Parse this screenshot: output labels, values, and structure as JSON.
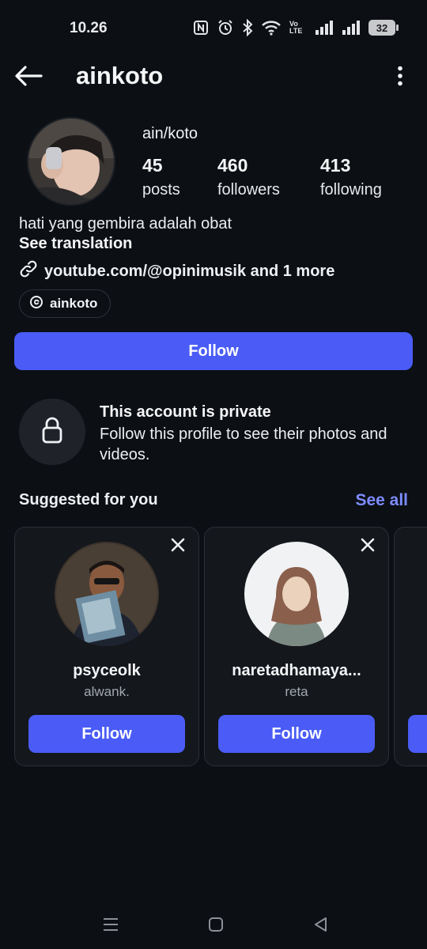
{
  "status_bar": {
    "time": "10.26",
    "battery": "32",
    "icons": [
      "nfc-icon",
      "alarm-icon",
      "bluetooth-icon",
      "wifi-icon",
      "volte-icon",
      "signal-icon",
      "signal-icon",
      "battery-icon"
    ],
    "volte_label": "Vo LTE"
  },
  "header": {
    "title": "ainkoto",
    "back_icon": "arrow-left-icon",
    "more_icon": "more-vertical-icon"
  },
  "profile": {
    "display_name": "ain/koto",
    "stats": [
      {
        "value": "45",
        "label": "posts"
      },
      {
        "value": "460",
        "label": "followers"
      },
      {
        "value": "413",
        "label": "following"
      }
    ],
    "bio": "hati yang gembira adalah obat",
    "see_translation": "See translation",
    "link_text": "youtube.com/@opinimusik and 1 more",
    "threads_handle": "ainkoto",
    "follow_label": "Follow"
  },
  "private_notice": {
    "title": "This account is private",
    "description": "Follow this profile to see their photos and videos."
  },
  "suggested": {
    "title": "Suggested for you",
    "see_all": "See all",
    "cards": [
      {
        "username": "psyceolk",
        "subtitle": "alwank.",
        "follow_label": "Follow"
      },
      {
        "username": "naretadhamaya...",
        "subtitle": "reta",
        "follow_label": "Follow"
      }
    ]
  },
  "colors": {
    "background": "#0c0f14",
    "accent": "#4a5cf5",
    "link": "#7d8cff",
    "card": "#14171c"
  },
  "nav_bar": {
    "icons": [
      "menu-icon",
      "home-square-icon",
      "back-triangle-icon"
    ]
  }
}
